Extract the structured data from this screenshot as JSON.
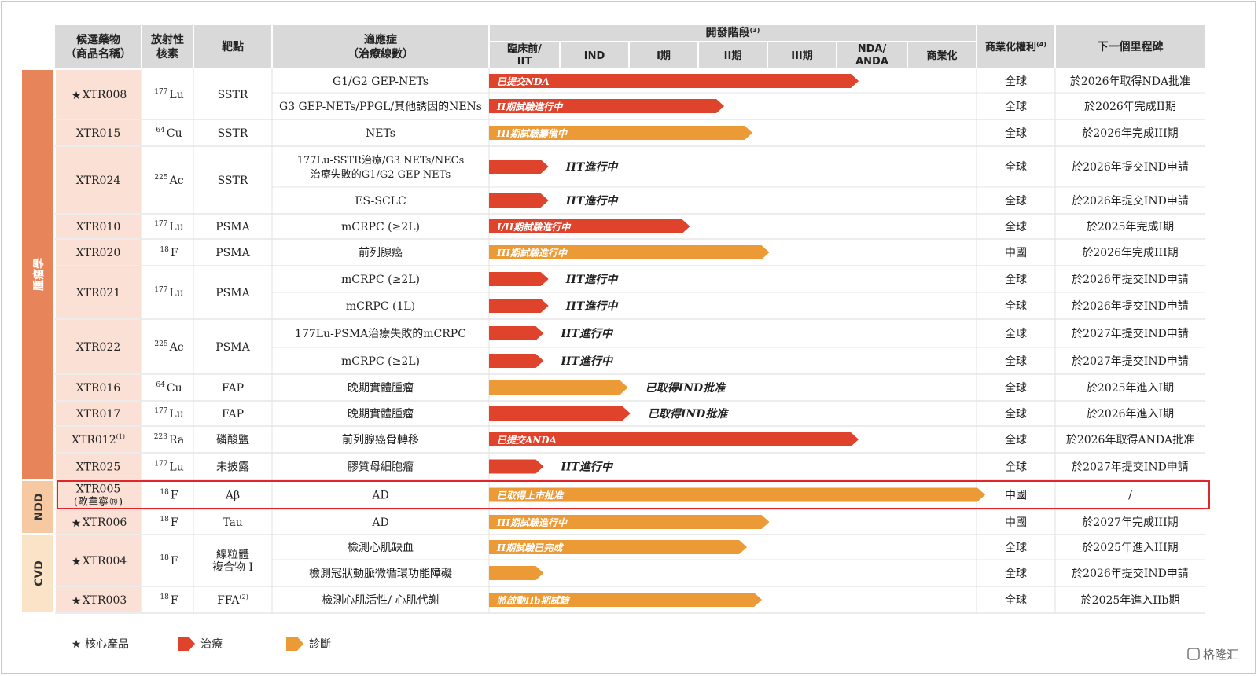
{
  "header": {
    "candidate_line1": "候選藥物",
    "candidate_line2": "（商品名稱）",
    "isotope_line1": "放射性",
    "isotope_line2": "核素",
    "target": "靶點",
    "indication_line1": "適應症",
    "indication_line2": "（治療線數）",
    "stage_title": "開發階段",
    "stage_title_note": "(3)",
    "rights": "商業化權利",
    "rights_note": "(4)",
    "milestone": "下一個里程碑",
    "stages": [
      [
        "臨床前/",
        "IIT"
      ],
      [
        "IND"
      ],
      [
        "I期"
      ],
      [
        "II期"
      ],
      [
        "III期"
      ],
      [
        "NDA/",
        "ANDA"
      ],
      [
        "商業化"
      ]
    ]
  },
  "categories": {
    "oncology": "腫瘤學",
    "ndd": "NDD",
    "cvd": "CVD"
  },
  "colors": {
    "therapy": "#e0432c",
    "diagnosis": "#ec9a36",
    "header_bg": "#d9d9d9",
    "oncology_side": "#e8845a",
    "ndd_side": "#f6c9a2",
    "cvd_side": "#fbe3c8",
    "row_tint": "#fbe0d6",
    "highlight": "#e0262a"
  },
  "chart_data": {
    "type": "table",
    "stages": [
      "臨床前/IIT",
      "IND",
      "I期",
      "II期",
      "III期",
      "NDA/ANDA",
      "商業化"
    ],
    "drugs": [
      {
        "name": "XTR008",
        "star": true,
        "isotope_mass": "177",
        "isotope": "Lu",
        "target": "SSTR",
        "indications": [
          {
            "text": [
              "G1/G2 GEP-NETs"
            ],
            "type": "therapy",
            "progress": 0.745,
            "bar_text": "已提交NDA",
            "rights": "全球",
            "milestone": "於2026年取得NDA批准"
          },
          {
            "text": [
              "G3 GEP-NETs/PPGL/其他誘因的NENs"
            ],
            "type": "therapy",
            "progress": 0.474,
            "bar_text": "II期試驗進行中",
            "rights": "全球",
            "milestone": "於2026年完成II期"
          }
        ]
      },
      {
        "name": "XTR015",
        "star": false,
        "isotope_mass": "64",
        "isotope": "Cu",
        "target": "SSTR",
        "indications": [
          {
            "text": [
              "NETs"
            ],
            "type": "diagnosis",
            "progress": 0.531,
            "bar_text": "III期試驗籌備中",
            "rights": "全球",
            "milestone": "於2026年完成III期"
          }
        ]
      },
      {
        "name": "XTR024",
        "star": false,
        "isotope_mass": "225",
        "isotope": "Ac",
        "target": "SSTR",
        "indications": [
          {
            "text": [
              "177Lu-SSTR治療/G3 NETs/NECs",
              "治療失敗的G1/G2 GEP-NETs"
            ],
            "type": "therapy",
            "progress": 0.12,
            "after_text": "IIT進行中",
            "rights": "全球",
            "milestone": "於2026年提交IND申請"
          },
          {
            "text": [
              "ES-SCLC"
            ],
            "type": "therapy",
            "progress": 0.12,
            "after_text": "IIT進行中",
            "rights": "全球",
            "milestone": "於2026年提交IND申請"
          }
        ]
      },
      {
        "name": "XTR010",
        "star": false,
        "isotope_mass": "177",
        "isotope": "Lu",
        "target": "PSMA",
        "indications": [
          {
            "text": [
              "mCRPC (≥2L)"
            ],
            "type": "therapy",
            "progress": 0.405,
            "bar_text": "I/II期試驗進行中",
            "rights": "全球",
            "milestone": "於2025年完成I期"
          }
        ]
      },
      {
        "name": "XTR020",
        "star": false,
        "isotope_mass": "18",
        "isotope": "F",
        "target": "PSMA",
        "indications": [
          {
            "text": [
              "前列腺癌"
            ],
            "type": "diagnosis",
            "progress": 0.565,
            "bar_text": "III期試驗進行中",
            "rights": "中國",
            "milestone": "於2026年完成III期"
          }
        ]
      },
      {
        "name": "XTR021",
        "star": false,
        "isotope_mass": "177",
        "isotope": "Lu",
        "target": "PSMA",
        "indications": [
          {
            "text": [
              "mCRPC (≥2L)"
            ],
            "type": "therapy",
            "progress": 0.12,
            "after_text": "IIT進行中",
            "rights": "全球",
            "milestone": "於2026年提交IND申請"
          },
          {
            "text": [
              "mCRPC (1L)"
            ],
            "type": "therapy",
            "progress": 0.12,
            "after_text": "IIT進行中",
            "rights": "全球",
            "milestone": "於2026年提交IND申請"
          }
        ]
      },
      {
        "name": "XTR022",
        "star": false,
        "isotope_mass": "225",
        "isotope": "Ac",
        "target": "PSMA",
        "indications": [
          {
            "text": [
              "177Lu-PSMA治療失敗的mCRPC"
            ],
            "type": "therapy",
            "progress": 0.11,
            "after_text": "IIT進行中",
            "rights": "全球",
            "milestone": "於2027年提交IND申請"
          },
          {
            "text": [
              "mCRPC (≥2L)"
            ],
            "type": "therapy",
            "progress": 0.11,
            "after_text": "IIT進行中",
            "rights": "全球",
            "milestone": "於2027年提交IND申請"
          }
        ]
      },
      {
        "name": "XTR016",
        "star": false,
        "isotope_mass": "64",
        "isotope": "Cu",
        "target": "FAP",
        "indications": [
          {
            "text": [
              "晚期實體腫瘤"
            ],
            "type": "diagnosis",
            "progress": 0.28,
            "after_text": "已取得IND批准",
            "rights": "全球",
            "milestone": "於2025年進入I期"
          }
        ]
      },
      {
        "name": "XTR017",
        "star": false,
        "isotope_mass": "177",
        "isotope": "Lu",
        "target": "FAP",
        "indications": [
          {
            "text": [
              "晚期實體腫瘤"
            ],
            "type": "therapy",
            "progress": 0.285,
            "after_text": "已取得IND批准",
            "rights": "全球",
            "milestone": "於2026年進入I期"
          }
        ]
      },
      {
        "name": "XTR012",
        "name_note": "(1)",
        "star": false,
        "isotope_mass": "223",
        "isotope": "Ra",
        "target": "磷酸鹽",
        "indications": [
          {
            "text": [
              "前列腺癌骨轉移"
            ],
            "type": "therapy",
            "progress": 0.745,
            "bar_text": "已提交ANDA",
            "rights": "全球",
            "milestone": "於2026年取得ANDA批准"
          }
        ]
      },
      {
        "name": "XTR025",
        "star": false,
        "isotope_mass": "177",
        "isotope": "Lu",
        "target": "未披露",
        "indications": [
          {
            "text": [
              "膠質母細胞瘤"
            ],
            "type": "therapy",
            "progress": 0.11,
            "after_text": "IIT進行中",
            "rights": "全球",
            "milestone": "於2027年提交IND申請"
          }
        ]
      },
      {
        "name": "XTR005",
        "name2": "(歐韋寧®)",
        "star": false,
        "highlight": true,
        "isotope_mass": "18",
        "isotope": "F",
        "target": "Aβ",
        "indications": [
          {
            "text": [
              "AD"
            ],
            "type": "diagnosis",
            "progress": 1.0,
            "bar_text": "已取得上市批准",
            "rights": "中國",
            "milestone": "/"
          }
        ]
      },
      {
        "name": "XTR006",
        "star": true,
        "isotope_mass": "18",
        "isotope": "F",
        "target": "Tau",
        "indications": [
          {
            "text": [
              "AD"
            ],
            "type": "diagnosis",
            "progress": 0.565,
            "bar_text": "III期試驗進行中",
            "rights": "中國",
            "milestone": "於2027年完成III期"
          }
        ]
      },
      {
        "name": "XTR004",
        "star": true,
        "isotope_mass": "18",
        "isotope": "F",
        "target": "線粒體",
        "target2": "複合物 I",
        "indications": [
          {
            "text": [
              "檢測心肌缺血"
            ],
            "type": "diagnosis",
            "progress": 0.52,
            "bar_text": "II期試驗已完成",
            "rights": "全球",
            "milestone": "於2025年進入III期"
          },
          {
            "text": [
              "檢測冠狀動脈微循環功能障礙"
            ],
            "type": "diagnosis",
            "progress": 0.11,
            "rights": "全球",
            "milestone": "於2026年提交IND申請"
          }
        ]
      },
      {
        "name": "XTR003",
        "star": true,
        "isotope_mass": "18",
        "isotope": "F",
        "target": "FFA",
        "target_note": "(2)",
        "indications": [
          {
            "text": [
              "檢測心肌活性/ 心肌代謝"
            ],
            "type": "diagnosis",
            "progress": 0.55,
            "bar_text": "將啟動IIb期試驗",
            "rights": "全球",
            "milestone": "於2025年進入IIb期"
          }
        ]
      }
    ]
  },
  "legend": {
    "core": "核心產品",
    "therapy": "治療",
    "diagnosis": "診斷"
  },
  "watermark": "格隆汇"
}
